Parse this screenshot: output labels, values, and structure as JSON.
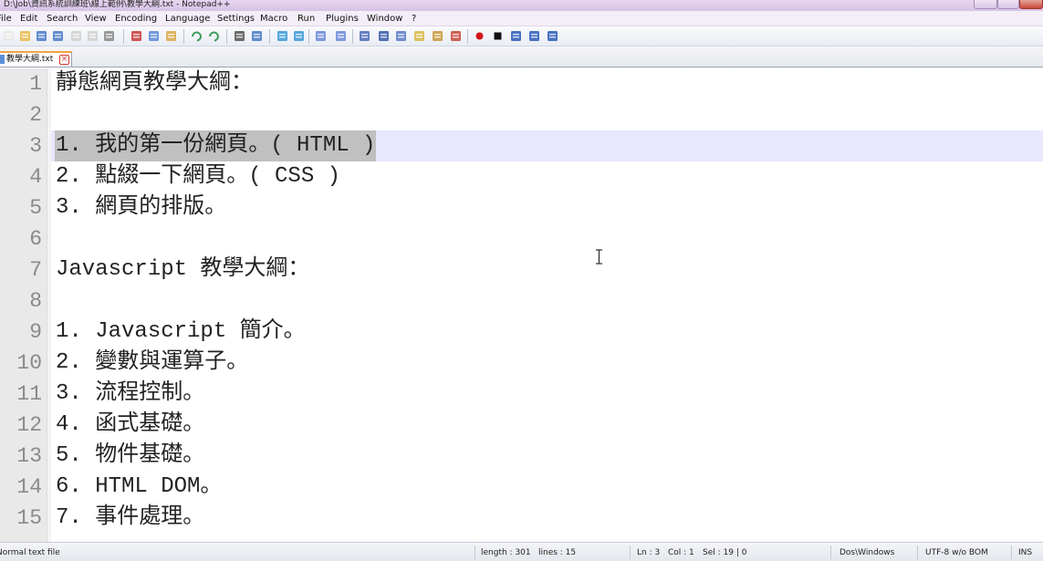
{
  "window": {
    "title": "D:\\Job\\資訊系統訓練班\\線上範例\\教學大綱.txt - Notepad++"
  },
  "menu": [
    "File",
    "Edit",
    "Search",
    "View",
    "Encoding",
    "Language",
    "Settings",
    "Macro",
    "Run",
    "Plugins",
    "Window",
    "?"
  ],
  "toolbar": {
    "icons": [
      "new-file-icon",
      "open-file-icon",
      "save-icon",
      "save-all-icon",
      "close-icon",
      "close-all-icon",
      "print-icon",
      "cut-icon",
      "copy-icon",
      "paste-icon",
      "undo-icon",
      "redo-icon",
      "find-icon",
      "replace-icon",
      "zoom-in-icon",
      "zoom-out-icon",
      "sync-vertical-icon",
      "sync-horizontal-icon",
      "word-wrap-icon",
      "show-all-chars-icon",
      "indent-guide-icon",
      "user-language-icon",
      "document-map-icon",
      "function-list-icon",
      "record-macro-icon",
      "stop-macro-icon",
      "play-macro-icon",
      "run-macro-multiple-icon",
      "save-macro-icon"
    ]
  },
  "tab": {
    "label": "教學大綱.txt"
  },
  "editor": {
    "current_line": 3,
    "selection_text": "1. 我的第一份網頁。( HTML )",
    "lines": [
      {
        "n": "1",
        "text": "靜態網頁教學大綱："
      },
      {
        "n": "2",
        "text": ""
      },
      {
        "n": "3",
        "text": "1. 我的第一份網頁。( HTML )"
      },
      {
        "n": "4",
        "text": "2. 點綴一下網頁。( CSS )"
      },
      {
        "n": "5",
        "text": "3. 網頁的排版。"
      },
      {
        "n": "6",
        "text": ""
      },
      {
        "n": "7",
        "text": "Javascript 教學大綱："
      },
      {
        "n": "8",
        "text": ""
      },
      {
        "n": "9",
        "text": "1. Javascript 簡介。"
      },
      {
        "n": "10",
        "text": "2. 變數與運算子。"
      },
      {
        "n": "11",
        "text": "3. 流程控制。"
      },
      {
        "n": "12",
        "text": "4. 函式基礎。"
      },
      {
        "n": "13",
        "text": "5. 物件基礎。"
      },
      {
        "n": "14",
        "text": "6. HTML DOM。"
      },
      {
        "n": "15",
        "text": "7. 事件處理。"
      }
    ]
  },
  "status": {
    "file_type": "Normal text file",
    "length": "length : 301",
    "lines": "lines : 15",
    "ln": "Ln : 3",
    "col": "Col : 1",
    "sel": "Sel : 19 | 0",
    "eol": "Dos\\Windows",
    "encoding": "UTF-8 w/o BOM",
    "mode": "INS"
  }
}
